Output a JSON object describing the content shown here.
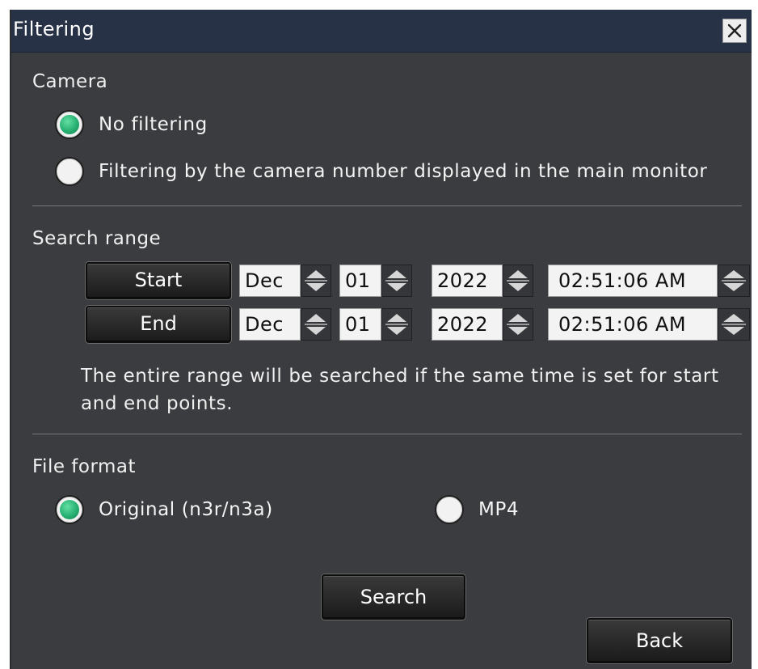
{
  "dialog": {
    "title": "Filtering",
    "close_icon": "close-icon"
  },
  "camera": {
    "label": "Camera",
    "options": [
      {
        "label": "No filtering",
        "selected": true
      },
      {
        "label": "Filtering by the camera number displayed in the main monitor",
        "selected": false
      }
    ]
  },
  "search_range": {
    "label": "Search range",
    "start": {
      "button": "Start",
      "month": "Dec",
      "day": "01",
      "year": "2022",
      "time": "02:51:06 AM"
    },
    "end": {
      "button": "End",
      "month": "Dec",
      "day": "01",
      "year": "2022",
      "time": "02:51:06 AM"
    },
    "note": "The entire range will be searched if the same time is set for start and end points."
  },
  "file_format": {
    "label": "File format",
    "options": [
      {
        "label": "Original (n3r/n3a)",
        "selected": true
      },
      {
        "label": "MP4",
        "selected": false
      }
    ]
  },
  "buttons": {
    "search": "Search",
    "back": "Back"
  },
  "colors": {
    "background": "#3b3c3f",
    "titlebar": "#273246",
    "radio_selected": "#27b072"
  }
}
